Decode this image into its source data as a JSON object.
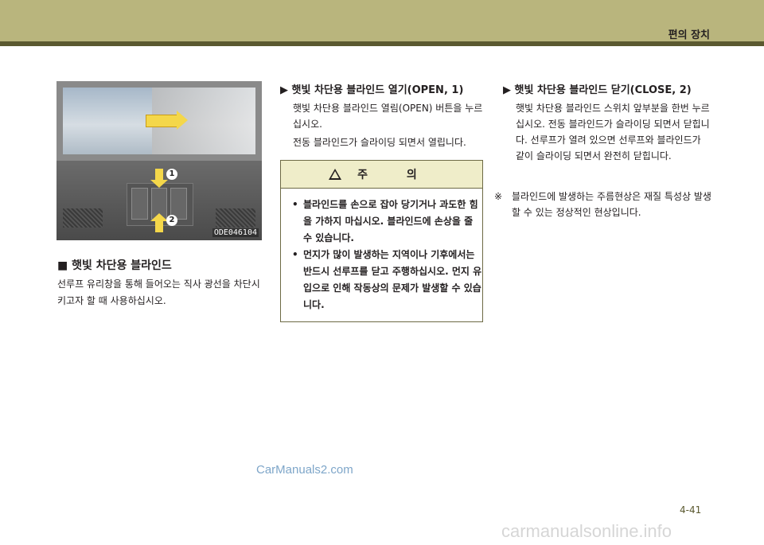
{
  "header": {
    "chapter_title": "편의 장치"
  },
  "figure": {
    "callouts": [
      "1",
      "2"
    ],
    "code": "ODE046104"
  },
  "left_section": {
    "title": "■ 햇빛 차단용 블라인드",
    "body": "선루프 유리창을 통해 들어오는 직사 광선을 차단시키고자 할 때 사용하십시오."
  },
  "open_section": {
    "title": "▶ 햇빛 차단용 블라인드 열기(OPEN, 1)",
    "lines": [
      "햇빛 차단용 블라인드 열림(OPEN) 버튼을 누르십시오.",
      "전동 블라인드가 슬라이딩 되면서 열립니다."
    ]
  },
  "caution": {
    "title": "주 의",
    "items": [
      "블라인드를 손으로 잡아 당기거나 과도한 힘을 가하지 마십시오. 블라인드에 손상을 줄 수 있습니다.",
      "먼지가 많이 발생하는 지역이나 기후에서는 반드시 선루프를 닫고 주행하십시오. 먼지 유입으로 인해 작동상의 문제가 발생할 수 있습니다."
    ]
  },
  "close_section": {
    "title": "▶ 햇빛 차단용 블라인드 닫기(CLOSE, 2)",
    "body": "햇빛 차단용 블라인드 스위치 앞부분을 한번 누르십시오. 전동 블라인드가 슬라이딩 되면서 닫힙니다. 선루프가 열려 있으면 선루프와 블라인드가 같이 슬라이딩 되면서 완전히 닫힙니다."
  },
  "note": {
    "mark": "※",
    "text": "블라인드에 발생하는 주름현상은 재질 특성상 발생할 수 있는 정상적인 현상입니다."
  },
  "watermark": "CarManuals2.com",
  "page_number": "4-41",
  "footer_site": "carmanualsonline.info"
}
